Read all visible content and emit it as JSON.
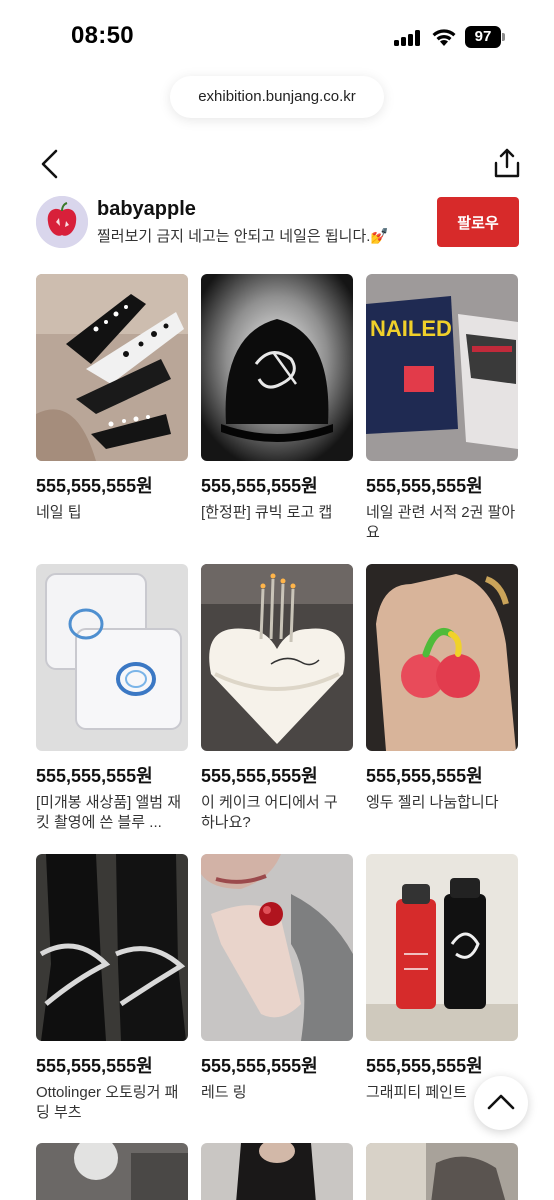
{
  "status_bar": {
    "time": "08:50",
    "battery": "97"
  },
  "browser": {
    "url": "exhibition.bunjang.co.kr"
  },
  "nav": {
    "back_icon": "chevron-left-icon",
    "share_icon": "share-icon"
  },
  "profile": {
    "username": "babyapple",
    "bio": "찔러보기 금지 네고는 안되고 네일은 됩니다.💅",
    "follow_label": "팔로우"
  },
  "products": [
    {
      "price": "555,555,555원",
      "title": "네일 팁"
    },
    {
      "price": "555,555,555원",
      "title": "[한정판] 큐빅 로고 캡"
    },
    {
      "price": "555,555,555원",
      "title": "네일 관련 서적 2권 팔아요"
    },
    {
      "price": "555,555,555원",
      "title": "[미개봉 새상품] 앨범 재킷 촬영에 쓴 블루 ..."
    },
    {
      "price": "555,555,555원",
      "title": "이 케이크 어디에서 구하나요?"
    },
    {
      "price": "555,555,555원",
      "title": "엥두 젤리 나눔합니다"
    },
    {
      "price": "555,555,555원",
      "title": "Ottolinger 오토링거 패딩 부츠"
    },
    {
      "price": "555,555,555원",
      "title": "레드 링"
    },
    {
      "price": "555,555,555원",
      "title": "그래피티 페인트"
    }
  ],
  "book_cover_text": "NAILED IT!",
  "colors": {
    "accent": "#d72a2a",
    "text": "#111111"
  }
}
